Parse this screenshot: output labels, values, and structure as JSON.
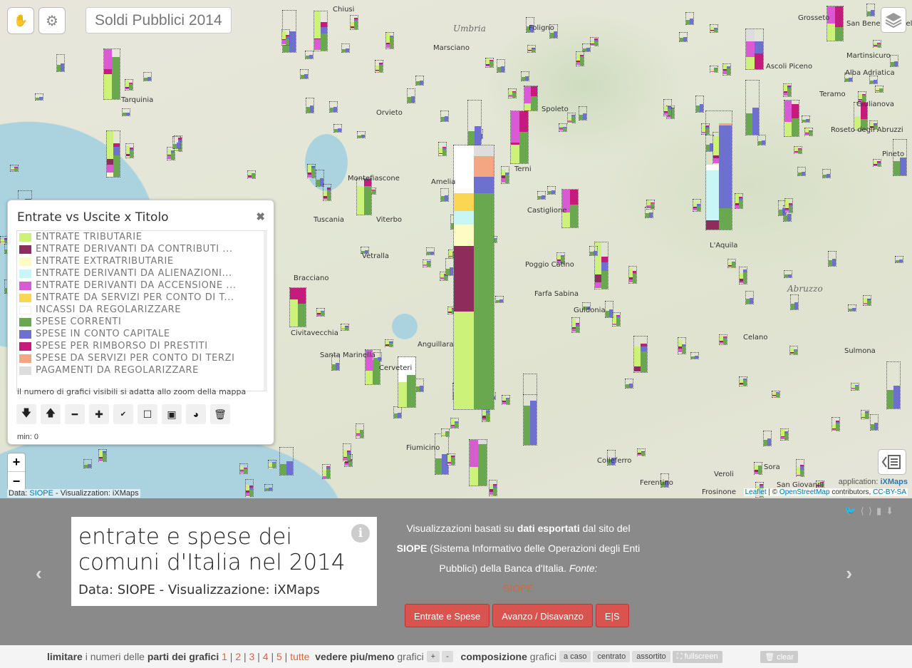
{
  "app": {
    "title": "Soldi Pubblici 2014"
  },
  "toolbar": {
    "hand_icon": "hand-icon",
    "settings_icon": "gear-icon"
  },
  "map": {
    "towns": [
      "Chiusi",
      "Foligno",
      "Marsciano",
      "Spoleto",
      "Orvieto",
      "Montefiascone",
      "Amelia",
      "Terni",
      "Castiglione",
      "Tuscania",
      "Viterbo",
      "Vetralla",
      "Poggio Catino",
      "Farfa Sabina",
      "Guidonia",
      "Civitavecchia",
      "Santa Marinella",
      "Cerveteri",
      "Anguillara",
      "Fiumicino",
      "Colleferro",
      "Ferentino",
      "Frosinone",
      "Veroli",
      "Sora",
      "L'Aquila",
      "Celano",
      "Sulmona",
      "Pineto",
      "Giulianova",
      "Roseto degli Abruzzi",
      "San Benedetto del Tronto",
      "Alba Adriatica",
      "Martinsicuro",
      "Ascoli Piceno",
      "Teramo",
      "Grosseto",
      "Tarquinia",
      "Bracciano",
      "San Giovanni"
    ],
    "regions": [
      "Umbria",
      "Abruzzo"
    ],
    "leaflet_link": "Leaflet",
    "osm_link": "OpenStreetMap",
    "osm_suffix": "contributors,",
    "license_link": "CC-BY-SA",
    "app_prefix": "application:",
    "app_brand": "iXMaps",
    "data_prefix": "Data:",
    "data_link": "SIOPE",
    "data_suffix": "- Visualizzation: iXMaps"
  },
  "legend": {
    "title": "Entrate vs Uscite x Titolo",
    "close": "✖",
    "items": [
      {
        "label": "ENTRATE TRIBUTARIE",
        "color": "#cdf27a"
      },
      {
        "label": "ENTRATE DERIVANTI DA CONTRIBUTI ...",
        "color": "#8e2c5c"
      },
      {
        "label": "ENTRATE EXTRATRIBUTARIE",
        "color": "#fefcc4"
      },
      {
        "label": "ENTRATE DERIVANTI DA ALIENAZIONI...",
        "color": "#c8f6f7"
      },
      {
        "label": "ENTRATE DERIVANTI DA ACCENSIONE ...",
        "color": "#da5ad6"
      },
      {
        "label": "ENTRATE DA SERVIZI PER CONTO DI T...",
        "color": "#fad652"
      },
      {
        "label": "INCASSI DA REGOLARIZZARE",
        "color": "#ffffff"
      },
      {
        "label": "SPESE CORRENTI",
        "color": "#6aa84f"
      },
      {
        "label": "SPESE IN CONTO CAPITALE",
        "color": "#6e70d0"
      },
      {
        "label": "SPESE PER RIMBORSO DI PRESTITI",
        "color": "#c51b7d"
      },
      {
        "label": "SPESE DA SERVIZI PER CONTO DI TERZI",
        "color": "#f4a582"
      },
      {
        "label": "PAGAMENTI DA REGOLARIZZARE",
        "color": "#dddddd"
      }
    ],
    "note": "il numero di grafici visibili si adatta allo zoom della mappa",
    "tools": [
      "arrow-down-icon",
      "arrow-up-icon",
      "minus-icon",
      "plus-icon",
      "spellcheck-icon",
      "empty-square-icon",
      "filled-square-icon",
      "pie-icon",
      "trash-icon"
    ],
    "min": "min: 0"
  },
  "zoom": {
    "in": "+",
    "out": "−"
  },
  "story": {
    "title": "entrate e spese dei comuni d'Italia nel 2014",
    "subtitle": "Data: SIOPE - Visualizzazione: iXMaps",
    "info": "i"
  },
  "description": {
    "p1": "Visualizzazioni basati su",
    "b1": "dati esportati",
    "p2": "dal sito del",
    "b2": "SIOPE",
    "p3": "(Sistema Informativo delle Operazioni degli Enti Pubblici) della Banca d'Italia.",
    "i1": "Fonte:",
    "src": "SIOPE"
  },
  "buttons": [
    "Entrate e Spese",
    "Avanzo / Disavanzo",
    "E|S"
  ],
  "bottom": {
    "limit_b": "limitare",
    "limit_t": "i numeri delle",
    "parts_b": "parti dei grafici",
    "nums": [
      "1",
      "2",
      "3",
      "4",
      "5",
      "tutte"
    ],
    "more_b": "vedere piu/meno",
    "more_t": "grafici",
    "plus": "+",
    "minus": "-",
    "comp_b": "composizione",
    "comp_t": "grafici",
    "opts": [
      "a caso",
      "centrato",
      "assortito"
    ],
    "fullscreen": "fullscreen",
    "clear": "clear"
  },
  "colors": {
    "accent": "#d9534f",
    "link": "#e06040",
    "panel": "#8a8a8a"
  }
}
